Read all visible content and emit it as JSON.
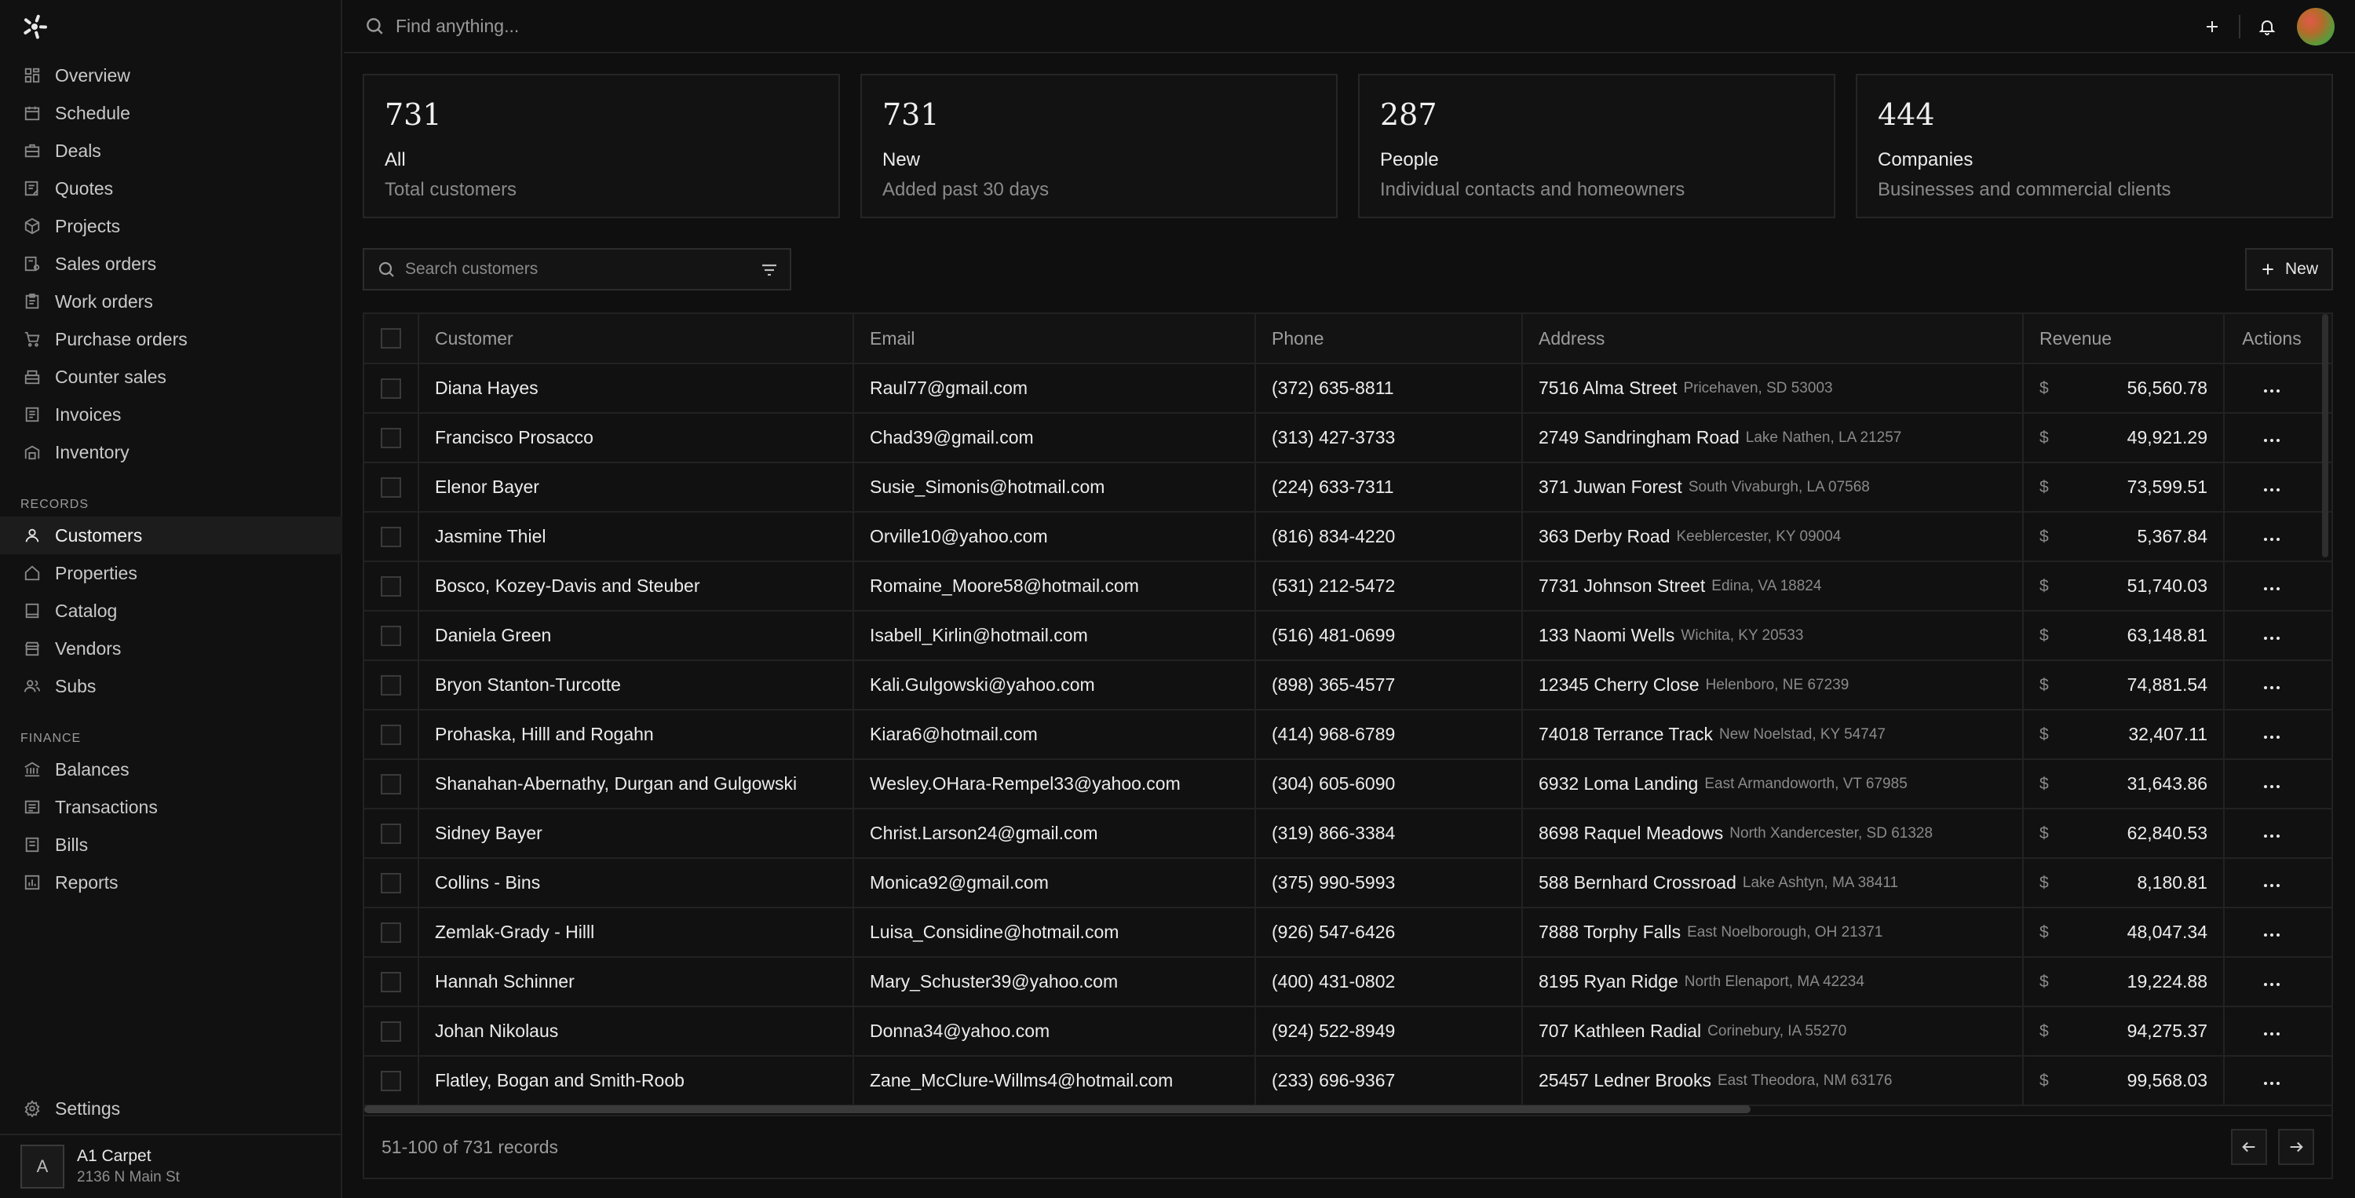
{
  "search": {
    "placeholder": "Find anything..."
  },
  "sidebar": {
    "main_items": [
      {
        "label": "Overview",
        "icon": "overview-icon"
      },
      {
        "label": "Schedule",
        "icon": "calendar-icon"
      },
      {
        "label": "Deals",
        "icon": "briefcase-icon"
      },
      {
        "label": "Quotes",
        "icon": "quote-icon"
      },
      {
        "label": "Projects",
        "icon": "cube-icon"
      },
      {
        "label": "Sales orders",
        "icon": "sales-order-icon"
      },
      {
        "label": "Work orders",
        "icon": "clipboard-icon"
      },
      {
        "label": "Purchase orders",
        "icon": "cart-icon"
      },
      {
        "label": "Counter sales",
        "icon": "register-icon"
      },
      {
        "label": "Invoices",
        "icon": "invoice-icon"
      },
      {
        "label": "Inventory",
        "icon": "warehouse-icon"
      }
    ],
    "records_label": "RECORDS",
    "records_items": [
      {
        "label": "Customers",
        "icon": "user-icon"
      },
      {
        "label": "Properties",
        "icon": "home-icon"
      },
      {
        "label": "Catalog",
        "icon": "book-icon"
      },
      {
        "label": "Vendors",
        "icon": "store-icon"
      },
      {
        "label": "Subs",
        "icon": "users-icon"
      }
    ],
    "finance_label": "FINANCE",
    "finance_items": [
      {
        "label": "Balances",
        "icon": "bank-icon"
      },
      {
        "label": "Transactions",
        "icon": "list-icon"
      },
      {
        "label": "Bills",
        "icon": "bill-icon"
      },
      {
        "label": "Reports",
        "icon": "chart-icon"
      }
    ],
    "settings_label": "Settings",
    "account": {
      "initial": "A",
      "name": "A1 Carpet",
      "address": "2136 N Main St"
    }
  },
  "stats": [
    {
      "value": "731",
      "label": "All",
      "sub": "Total customers"
    },
    {
      "value": "731",
      "label": "New",
      "sub": "Added past 30 days"
    },
    {
      "value": "287",
      "label": "People",
      "sub": "Individual contacts and homeowners"
    },
    {
      "value": "444",
      "label": "Companies",
      "sub": "Businesses and commercial clients"
    }
  ],
  "table_search": {
    "placeholder": "Search customers"
  },
  "new_button": "New",
  "columns": {
    "customer": "Customer",
    "email": "Email",
    "phone": "Phone",
    "address": "Address",
    "revenue": "Revenue",
    "actions": "Actions"
  },
  "currency": "$",
  "rows": [
    {
      "customer": "Diana Hayes",
      "email": "Raul77@gmail.com",
      "phone": "(372) 635-8811",
      "street": "7516 Alma Street",
      "city": "Pricehaven, SD 53003",
      "revenue": "56,560.78"
    },
    {
      "customer": "Francisco Prosacco",
      "email": "Chad39@gmail.com",
      "phone": "(313) 427-3733",
      "street": "2749 Sandringham Road",
      "city": "Lake Nathen, LA 21257",
      "revenue": "49,921.29"
    },
    {
      "customer": "Elenor Bayer",
      "email": "Susie_Simonis@hotmail.com",
      "phone": "(224) 633-7311",
      "street": "371 Juwan Forest",
      "city": "South Vivaburgh, LA 07568",
      "revenue": "73,599.51"
    },
    {
      "customer": "Jasmine Thiel",
      "email": "Orville10@yahoo.com",
      "phone": "(816) 834-4220",
      "street": "363 Derby Road",
      "city": "Keeblercester, KY 09004",
      "revenue": "5,367.84"
    },
    {
      "customer": "Bosco, Kozey-Davis and Steuber",
      "email": "Romaine_Moore58@hotmail.com",
      "phone": "(531) 212-5472",
      "street": "7731 Johnson Street",
      "city": "Edina, VA 18824",
      "revenue": "51,740.03"
    },
    {
      "customer": "Daniela Green",
      "email": "Isabell_Kirlin@hotmail.com",
      "phone": "(516) 481-0699",
      "street": "133 Naomi Wells",
      "city": "Wichita, KY 20533",
      "revenue": "63,148.81"
    },
    {
      "customer": "Bryon Stanton-Turcotte",
      "email": "Kali.Gulgowski@yahoo.com",
      "phone": "(898) 365-4577",
      "street": "12345 Cherry Close",
      "city": "Helenboro, NE 67239",
      "revenue": "74,881.54"
    },
    {
      "customer": "Prohaska, Hilll and Rogahn",
      "email": "Kiara6@hotmail.com",
      "phone": "(414) 968-6789",
      "street": "74018 Terrance Track",
      "city": "New Noelstad, KY 54747",
      "revenue": "32,407.11"
    },
    {
      "customer": "Shanahan-Abernathy, Durgan and Gulgowski",
      "email": "Wesley.OHara-Rempel33@yahoo.com",
      "phone": "(304) 605-6090",
      "street": "6932 Loma Landing",
      "city": "East Armandoworth, VT 67985",
      "revenue": "31,643.86"
    },
    {
      "customer": "Sidney Bayer",
      "email": "Christ.Larson24@gmail.com",
      "phone": "(319) 866-3384",
      "street": "8698 Raquel Meadows",
      "city": "North Xandercester, SD 61328",
      "revenue": "62,840.53"
    },
    {
      "customer": "Collins - Bins",
      "email": "Monica92@gmail.com",
      "phone": "(375) 990-5993",
      "street": "588 Bernhard Crossroad",
      "city": "Lake Ashtyn, MA 38411",
      "revenue": "8,180.81"
    },
    {
      "customer": "Zemlak-Grady - Hilll",
      "email": "Luisa_Considine@hotmail.com",
      "phone": "(926) 547-6426",
      "street": "7888 Torphy Falls",
      "city": "East Noelborough, OH 21371",
      "revenue": "48,047.34"
    },
    {
      "customer": "Hannah Schinner",
      "email": "Mary_Schuster39@yahoo.com",
      "phone": "(400) 431-0802",
      "street": "8195 Ryan Ridge",
      "city": "North Elenaport, MA 42234",
      "revenue": "19,224.88"
    },
    {
      "customer": "Johan Nikolaus",
      "email": "Donna34@yahoo.com",
      "phone": "(924) 522-8949",
      "street": "707 Kathleen Radial",
      "city": "Corinebury, IA 55270",
      "revenue": "94,275.37"
    },
    {
      "customer": "Flatley, Bogan and Smith-Roob",
      "email": "Zane_McClure-Willms4@hotmail.com",
      "phone": "(233) 696-9367",
      "street": "25457 Ledner Brooks",
      "city": "East Theodora, NM 63176",
      "revenue": "99,568.03"
    }
  ],
  "footer": {
    "records": "51-100 of 731 records"
  }
}
